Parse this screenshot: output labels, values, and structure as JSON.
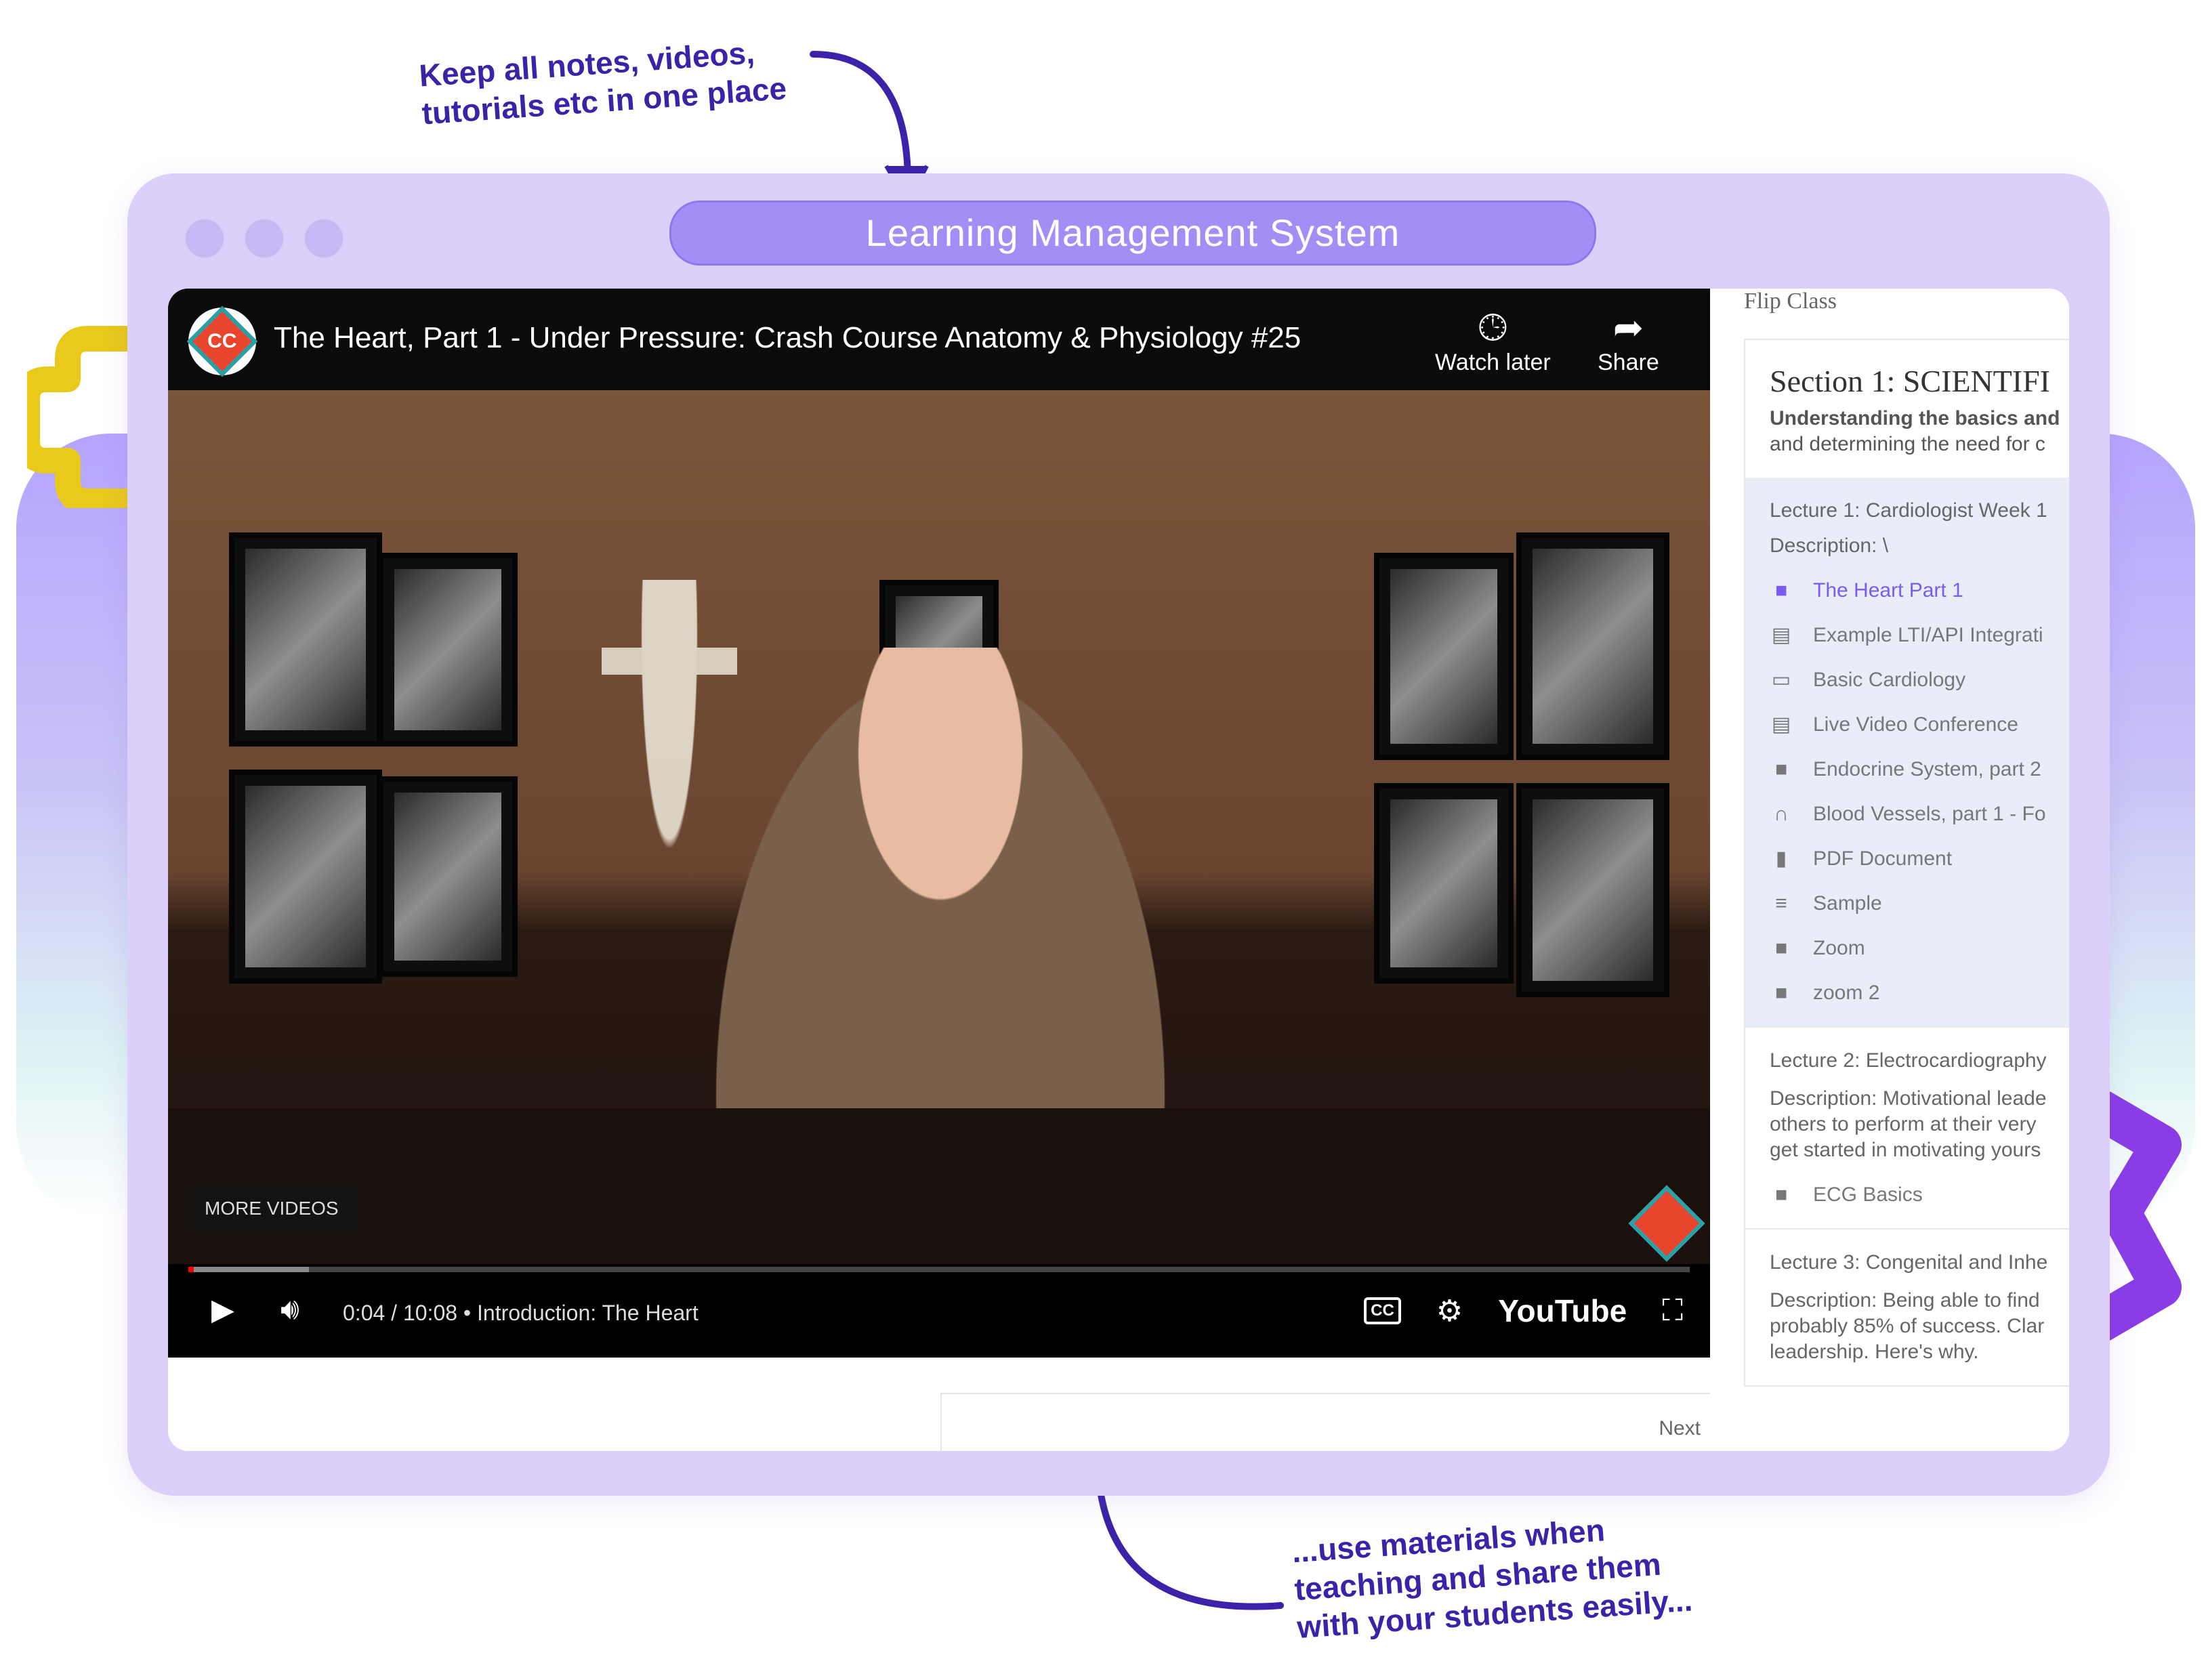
{
  "annotations": {
    "top_note": "Keep all notes, videos, tutorials etc in one place",
    "bottom_note": "...use materials when teaching and share them with your students easily..."
  },
  "window": {
    "title": "Learning Management System"
  },
  "video": {
    "channel_logo_text": "CC",
    "title": "The Heart, Part 1 - Under Pressure: Crash Course Anatomy & Physiology #25",
    "watch_later": "Watch later",
    "share": "Share",
    "more_videos": "MORE VIDEOS",
    "time": "0:04 / 10:08",
    "chapter": "• Introduction: The Heart",
    "cc_label": "CC",
    "brand": "YouTube",
    "progress_fraction": 0.0066
  },
  "pager": {
    "next": "Next"
  },
  "sidebar": {
    "course": "Flip Class",
    "section": {
      "title": "Section 1: SCIENTIFI",
      "desc_bold": "Understanding the basics and",
      "desc": "and determining the need for c"
    },
    "lecture1": {
      "title": "Lecture 1: Cardiologist Week 1",
      "desc": "Description: \\",
      "items": [
        {
          "label": "The Heart Part 1",
          "icon": "video-icon"
        },
        {
          "label": "Example LTI/API Integrati",
          "icon": "document-icon"
        },
        {
          "label": "Basic Cardiology",
          "icon": "monitor-icon"
        },
        {
          "label": "Live Video Conference",
          "icon": "document-icon"
        },
        {
          "label": "Endocrine System, part 2",
          "icon": "video-icon"
        },
        {
          "label": "Blood Vessels, part 1 - Fo",
          "icon": "headphones-icon"
        },
        {
          "label": "PDF Document",
          "icon": "book-icon"
        },
        {
          "label": "Sample",
          "icon": "list-icon"
        },
        {
          "label": "Zoom",
          "icon": "video-icon"
        },
        {
          "label": "zoom 2",
          "icon": "video-icon"
        }
      ]
    },
    "lecture2": {
      "title": "Lecture 2: Electrocardiography",
      "desc1": "Description: Motivational leade",
      "desc2": "others to perform at their very",
      "desc3": "get started in motivating yours",
      "item": "ECG Basics"
    },
    "lecture3": {
      "title": "Lecture 3: Congenital and Inhe",
      "desc1": "Description: Being able to find",
      "desc2": "probably 85% of success. Clar",
      "desc3": "leadership. Here's why."
    }
  },
  "colors": {
    "accent": "#7a5cf0",
    "window_bg": "#dcd0fb",
    "pill": "#a48ef5",
    "annotation": "#3b22a8"
  }
}
